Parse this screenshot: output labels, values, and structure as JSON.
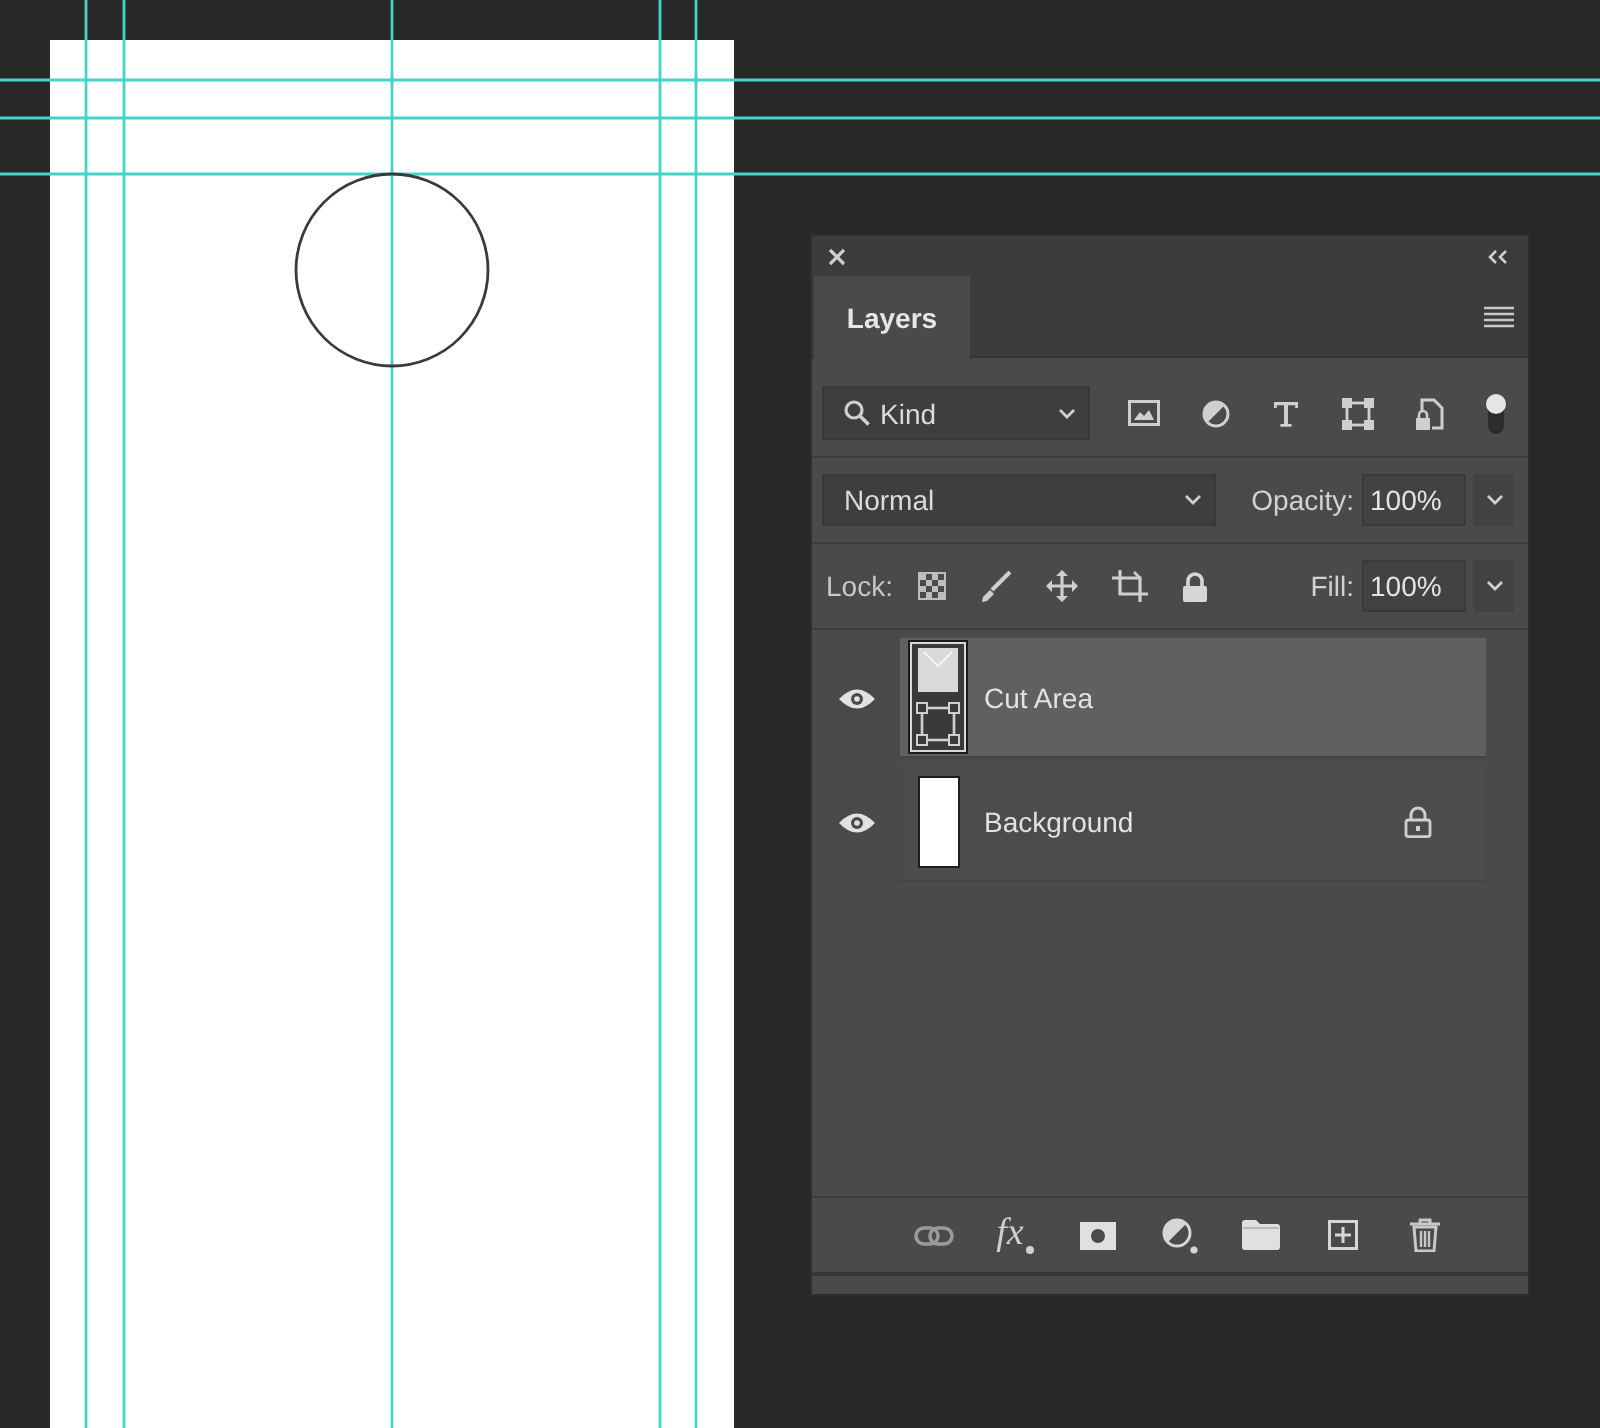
{
  "panel": {
    "tabs": [
      {
        "label": "Layers",
        "selected": true
      }
    ],
    "filter": {
      "value": "Kind",
      "enabled": true
    },
    "blend_mode": {
      "value": "Normal"
    },
    "opacity": {
      "label": "Opacity:",
      "value": "100%"
    },
    "lock": {
      "label": "Lock:"
    },
    "fill": {
      "label": "Fill:",
      "value": "100%"
    },
    "layers": [
      {
        "name": "Cut Area",
        "kind": "shape",
        "visible": true,
        "selected": true,
        "locked": false
      },
      {
        "name": "Background",
        "kind": "pixel",
        "visible": true,
        "selected": false,
        "locked": true
      }
    ],
    "footer": {
      "effects_label": "fx"
    }
  }
}
